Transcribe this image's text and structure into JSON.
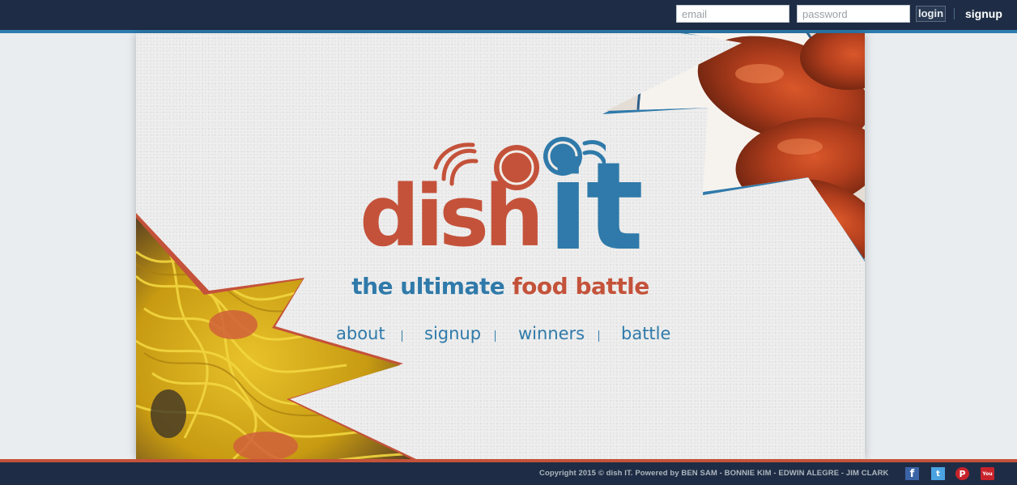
{
  "header": {
    "email_placeholder": "email",
    "password_placeholder": "password",
    "login_label": "login",
    "signup_label": "signup"
  },
  "logo": {
    "word1": "dish",
    "word2": "it",
    "tagline_part1": "the ultimate",
    "tagline_part2": "food battle"
  },
  "nav": {
    "items": [
      {
        "label": "about"
      },
      {
        "label": "signup"
      },
      {
        "label": "winners"
      },
      {
        "label": "battle"
      }
    ],
    "separator": "|"
  },
  "footer": {
    "copyright": "Copyright 2015 © dish IT. Powered by BEN SAM - BONNIE KIM - EDWIN ALEGRE - JIM CLARK",
    "social": [
      {
        "icon": "facebook-icon",
        "glyph": "f"
      },
      {
        "icon": "twitter-icon",
        "glyph": "t"
      },
      {
        "icon": "pinterest-icon",
        "glyph": "P"
      },
      {
        "icon": "youtube-icon",
        "glyph": "You"
      }
    ]
  },
  "colors": {
    "navy": "#1e2d45",
    "brand_blue": "#2f7aaa",
    "brand_red": "#c4523a",
    "background": "#e9edf0"
  }
}
